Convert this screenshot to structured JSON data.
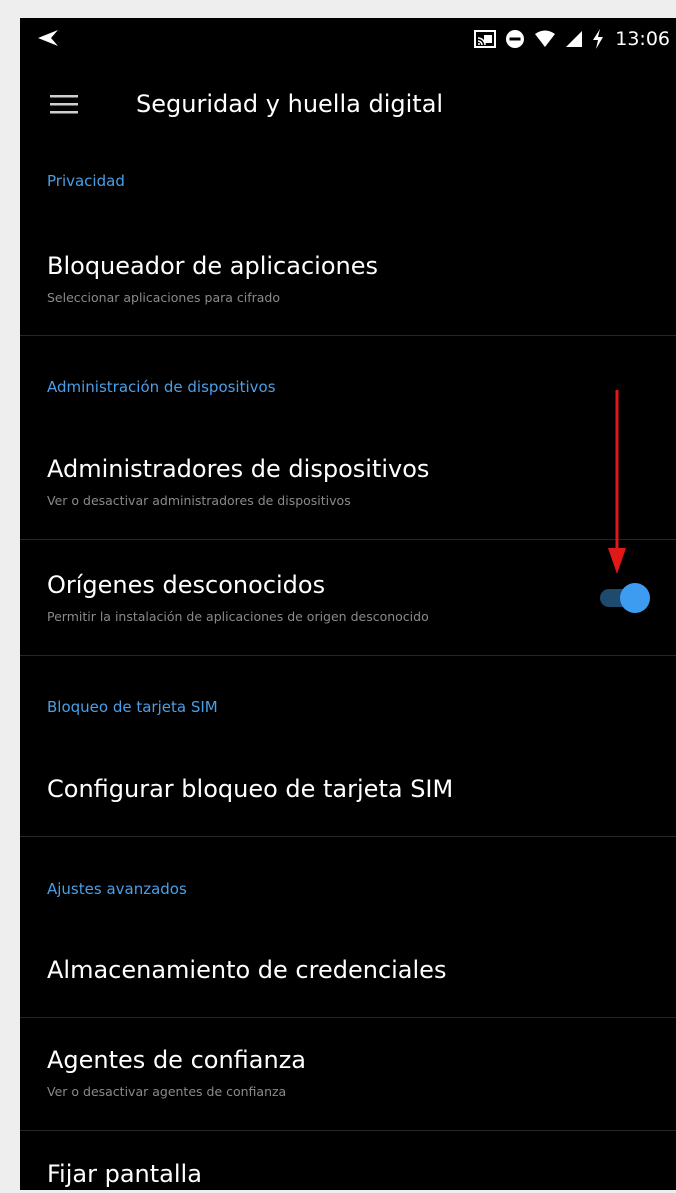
{
  "status_bar": {
    "time": "13:06",
    "icons": [
      "back-arrow-icon",
      "cast-icon",
      "do-not-disturb-icon",
      "wifi-icon",
      "signal-icon",
      "battery-charging-icon"
    ]
  },
  "toolbar": {
    "title": "Seguridad y huella digital",
    "menu_icon": "hamburger-menu-icon"
  },
  "sections": [
    {
      "header": "Privacidad",
      "items": [
        {
          "title": "Bloqueador de aplicaciones",
          "subtitle": "Seleccionar aplicaciones para cifrado"
        }
      ]
    },
    {
      "header": "Administración de dispositivos",
      "items": [
        {
          "title": "Administradores de dispositivos",
          "subtitle": "Ver o desactivar administradores de dispositivos"
        },
        {
          "title": "Orígenes desconocidos",
          "subtitle": "Permitir la instalación de aplicaciones de origen desconocido",
          "toggle_on": true
        }
      ]
    },
    {
      "header": "Bloqueo de tarjeta SIM",
      "items": [
        {
          "title": "Configurar bloqueo de tarjeta SIM"
        }
      ]
    },
    {
      "header": "Ajustes avanzados",
      "items": [
        {
          "title": "Almacenamiento de credenciales"
        },
        {
          "title": "Agentes de confianza",
          "subtitle": "Ver o desactivar agentes de confianza"
        },
        {
          "title": "Fijar pantalla"
        }
      ]
    }
  ],
  "colors": {
    "background": "#000000",
    "accent": "#4a9fe8",
    "toggle_on": "#3d9cf0",
    "annotation_arrow": "#e01818"
  }
}
